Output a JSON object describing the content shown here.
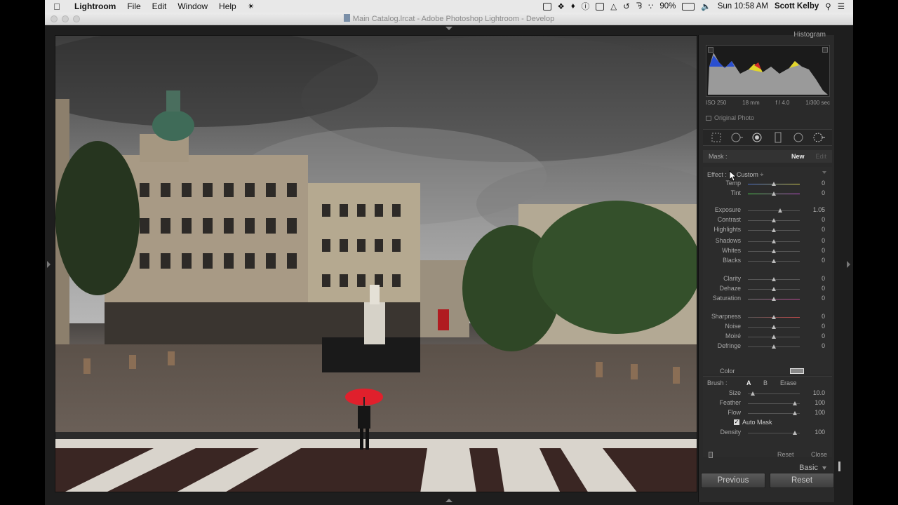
{
  "menubar": {
    "apple_symbol": "",
    "app_name": "Lightroom",
    "menus": [
      "File",
      "Edit",
      "Window",
      "Help"
    ],
    "battery": "90%",
    "datetime": "Sun 10:58 AM",
    "user": "Scott Kelby"
  },
  "window": {
    "title": "Main Catalog.lrcat - Adobe Photoshop Lightroom - Develop"
  },
  "histogram": {
    "header": "Histogram",
    "iso": "ISO 250",
    "focal": "18 mm",
    "aperture": "f / 4.0",
    "shutter": "1/300 sec",
    "original_photo_label": "Original Photo"
  },
  "mask": {
    "label": "Mask :",
    "new_label": "New",
    "edit_label": "Edit"
  },
  "effect": {
    "label": "Effect :",
    "value": "Custom ÷"
  },
  "sliders": [
    {
      "label": "Temp",
      "value": "0",
      "pos": 0.5
    },
    {
      "label": "Tint",
      "value": "0",
      "pos": 0.5
    },
    {
      "label": "Exposure",
      "value": "1.05",
      "pos": 0.62
    },
    {
      "label": "Contrast",
      "value": "0",
      "pos": 0.5
    },
    {
      "label": "Highlights",
      "value": "0",
      "pos": 0.5
    },
    {
      "label": "Shadows",
      "value": "0",
      "pos": 0.5
    },
    {
      "label": "Whites",
      "value": "0",
      "pos": 0.5
    },
    {
      "label": "Blacks",
      "value": "0",
      "pos": 0.5
    },
    {
      "label": "Clarity",
      "value": "0",
      "pos": 0.5
    },
    {
      "label": "Dehaze",
      "value": "0",
      "pos": 0.5
    },
    {
      "label": "Saturation",
      "value": "0",
      "pos": 0.5
    },
    {
      "label": "Sharpness",
      "value": "0",
      "pos": 0.5
    },
    {
      "label": "Noise",
      "value": "0",
      "pos": 0.5
    },
    {
      "label": "Moiré",
      "value": "0",
      "pos": 0.5
    },
    {
      "label": "Defringe",
      "value": "0",
      "pos": 0.5
    }
  ],
  "color_label": "Color",
  "brush": {
    "label": "Brush :",
    "a": "A",
    "b": "B",
    "erase": "Erase",
    "size_label": "Size",
    "size_value": "10.0",
    "feather_label": "Feather",
    "feather_value": "100",
    "flow_label": "Flow",
    "flow_value": "100",
    "automask_label": "Auto Mask",
    "density_label": "Density",
    "density_value": "100"
  },
  "footer": {
    "reset": "Reset",
    "close": "Close"
  },
  "basic_label": "Basic",
  "buttons": {
    "previous": "Previous",
    "reset": "Reset"
  },
  "colors": {
    "panel_bg": "#2c2c2c",
    "app_bg": "#1e1e1e",
    "umbrella_red": "#e0202c",
    "sky_gray": "#7a7a7a"
  }
}
